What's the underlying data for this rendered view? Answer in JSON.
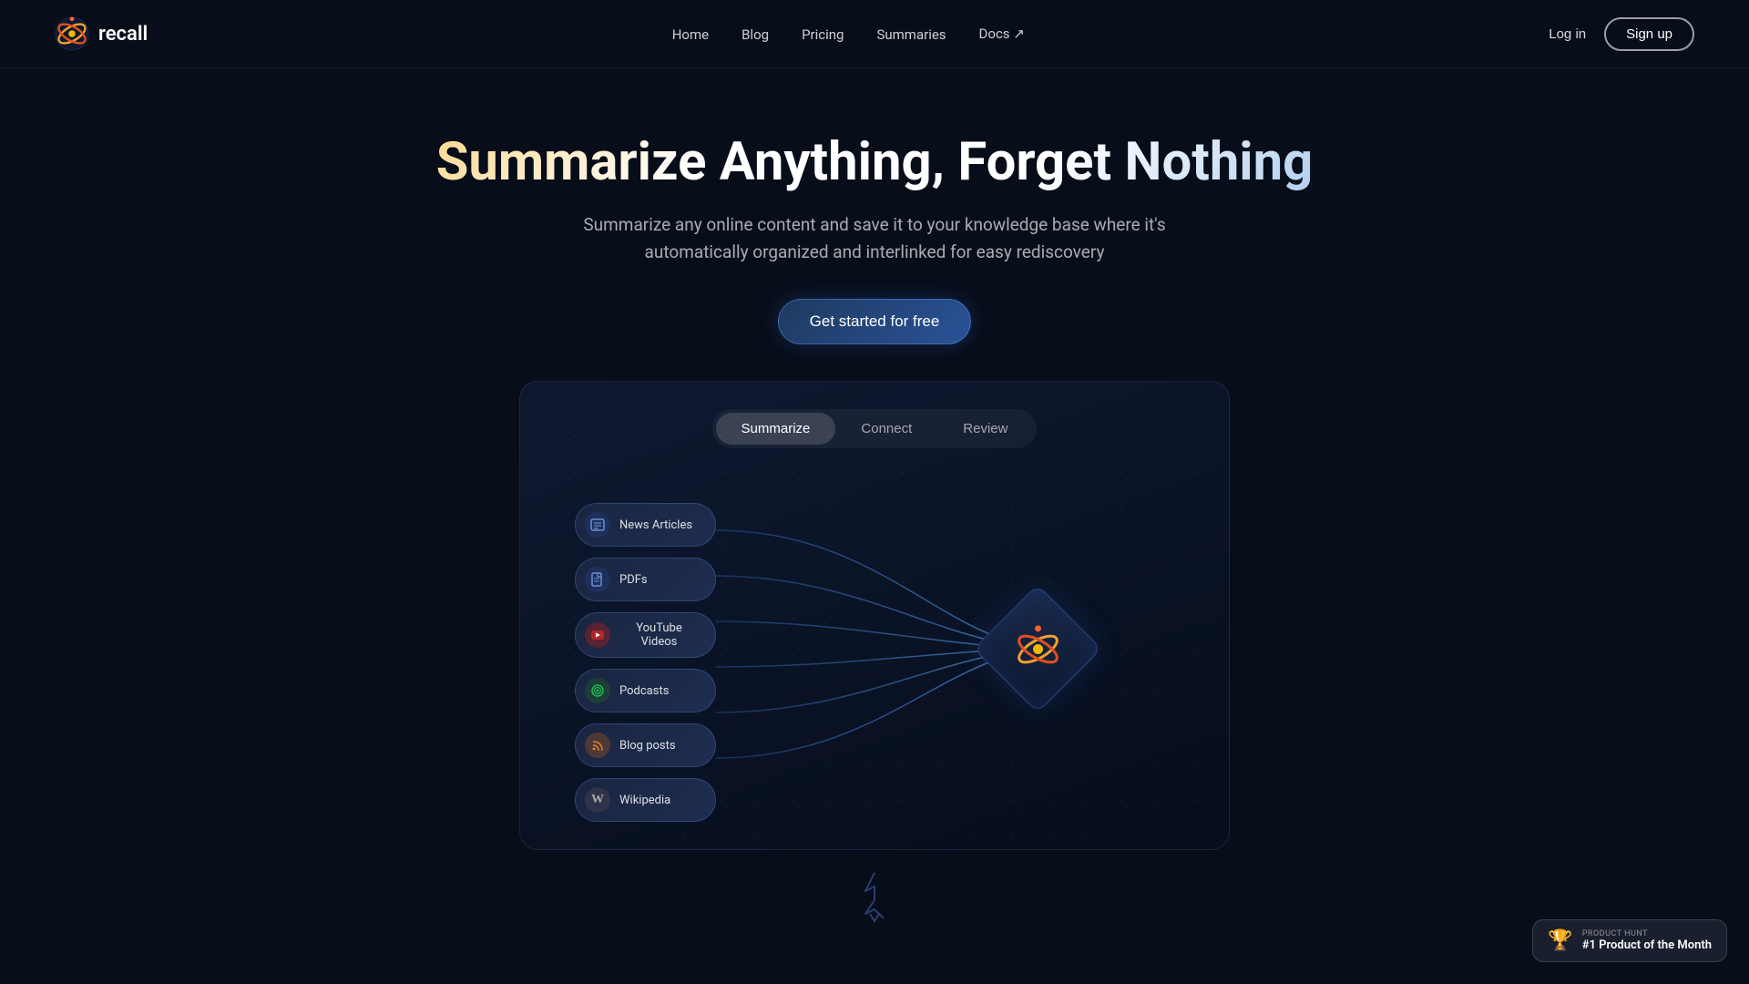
{
  "nav": {
    "logo_text": "recall",
    "links": [
      {
        "id": "home",
        "label": "Home",
        "href": "#"
      },
      {
        "id": "blog",
        "label": "Blog",
        "href": "#"
      },
      {
        "id": "pricing",
        "label": "Pricing",
        "href": "#"
      },
      {
        "id": "summaries",
        "label": "Summaries",
        "href": "#"
      },
      {
        "id": "docs",
        "label": "Docs ↗",
        "href": "#"
      }
    ],
    "login_label": "Log in",
    "signup_label": "Sign up"
  },
  "hero": {
    "title": "Summarize Anything, Forget Nothing",
    "subtitle": "Summarize any online content and save it to your knowledge base where it's automatically organized and interlinked for easy rediscovery",
    "cta_label": "Get started for free"
  },
  "demo": {
    "tabs": [
      {
        "id": "summarize",
        "label": "Summarize",
        "active": true
      },
      {
        "id": "connect",
        "label": "Connect",
        "active": false
      },
      {
        "id": "review",
        "label": "Review",
        "active": false
      }
    ],
    "sources": [
      {
        "id": "news-articles",
        "label": "News Articles",
        "icon": "📰"
      },
      {
        "id": "pdfs",
        "label": "PDFs",
        "icon": "📄"
      },
      {
        "id": "youtube-videos",
        "label": "YouTube Videos",
        "icon": "▶"
      },
      {
        "id": "podcasts",
        "label": "Podcasts",
        "icon": "🎵"
      },
      {
        "id": "blog-posts",
        "label": "Blog posts",
        "icon": "📡"
      },
      {
        "id": "wikipedia",
        "label": "Wikipedia",
        "icon": "W"
      }
    ]
  },
  "product_hunt": {
    "label": "PRODUCT HUNT",
    "title": "#1 Product of the Month"
  }
}
